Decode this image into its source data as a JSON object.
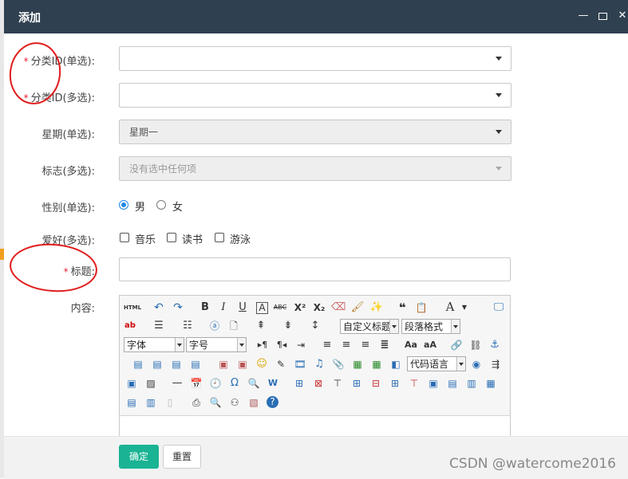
{
  "window": {
    "title": "添加"
  },
  "fields": {
    "category_single": {
      "label": "分类ID(单选):",
      "value": ""
    },
    "category_multi": {
      "label": "分类ID(多选):",
      "value": ""
    },
    "weekday": {
      "label": "星期(单选):",
      "value": "星期一"
    },
    "tags": {
      "label": "标志(多选):",
      "placeholder": "没有选中任何项"
    },
    "gender": {
      "label": "性别(单选):",
      "options": [
        "男",
        "女"
      ],
      "selected": "男"
    },
    "hobby": {
      "label": "爱好(多选):",
      "options": [
        "音乐",
        "读书",
        "游泳"
      ]
    },
    "title": {
      "label": "标题:",
      "value": ""
    },
    "content": {
      "label": "内容:"
    }
  },
  "required_mark": "*",
  "editor": {
    "html_label": "HTML",
    "custom_title": "自定义标题",
    "paragraph_format": "段落格式",
    "font_family": "字体",
    "font_size": "字号",
    "code_language": "代码语言",
    "text_color_glyph": "A"
  },
  "buttons": {
    "confirm": "确定",
    "reset": "重置"
  },
  "watermark": "CSDN @watercome2016",
  "colors": {
    "titlebar": "#2f4050",
    "primary": "#1ab394",
    "required": "#e23333",
    "annotation": "#e11d1d"
  }
}
